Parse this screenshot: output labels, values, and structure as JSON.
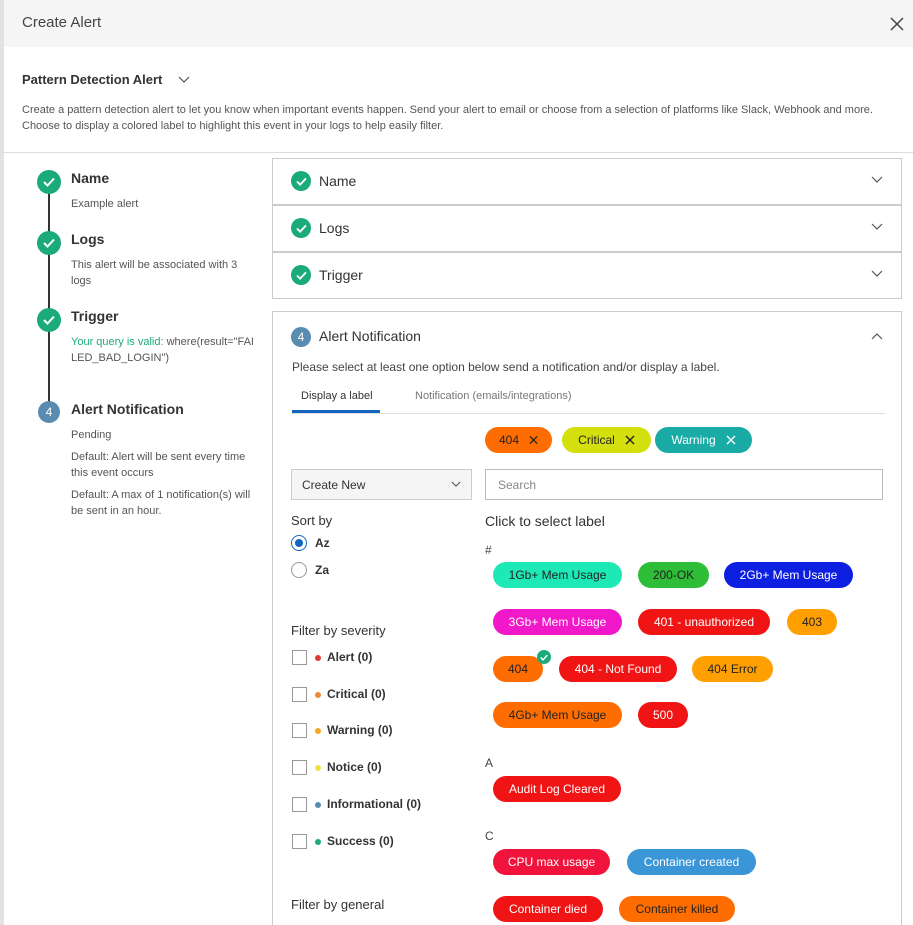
{
  "header": {
    "title": "Create Alert"
  },
  "alert_type": {
    "value": "Pattern Detection Alert"
  },
  "description": "Create a pattern detection alert to let you know when important events happen. Send your alert to email or choose from a selection of platforms like Slack, Webhook and more. Choose to display a colored label to highlight this event in your logs to help easily filter.",
  "steps": {
    "name": {
      "title": "Name",
      "desc": "Example alert"
    },
    "logs": {
      "title": "Logs",
      "desc": "This alert will be associated with 3 logs"
    },
    "trigger": {
      "title": "Trigger",
      "valid_text": "Your query is valid",
      "query": "where(result=\"FAILED_BAD_LOGIN\")"
    },
    "notification": {
      "number": "4",
      "title": "Alert Notification",
      "status": "Pending",
      "default1": "Default: Alert will be sent every time this event occurs",
      "default2": "Default: A max of 1 notification(s) will be sent in an hour."
    }
  },
  "panels": {
    "name": "Name",
    "logs": "Logs",
    "trigger": "Trigger"
  },
  "notification": {
    "number": "4",
    "title": "Alert Notification",
    "instruction": "Please select at least one option below send a notification and/or display a label.",
    "tabs": [
      "Display a label",
      "Notification (emails/integrations)"
    ],
    "selected": [
      {
        "label": "404",
        "bg": "#ff6d00",
        "color": "#222"
      },
      {
        "label": "Critical",
        "bg": "#d4e00e",
        "color": "#222"
      },
      {
        "label": "Warning",
        "bg": "#19aca6",
        "color": "#fff"
      }
    ],
    "dropdown": "Create New",
    "search_placeholder": "Search",
    "click_label": "Click to select label",
    "sort_by": "Sort by",
    "sort_options": [
      "Az",
      "Za"
    ],
    "filter_severity": "Filter by severity",
    "severities": [
      {
        "label": "Alert (0)",
        "color": "#e53935"
      },
      {
        "label": "Critical (0)",
        "color": "#ef8a33"
      },
      {
        "label": "Warning (0)",
        "color": "#f5a623"
      },
      {
        "label": "Notice (0)",
        "color": "#f5e04a"
      },
      {
        "label": "Informational (0)",
        "color": "#5a8bb0"
      },
      {
        "label": "Success (0)",
        "color": "#1aaa7c"
      }
    ],
    "filter_general": "Filter by general",
    "groups": [
      {
        "letter": "#",
        "labels": [
          {
            "label": "1Gb+ Mem Usage",
            "bg": "#1de9b6",
            "color": "#222"
          },
          {
            "label": "200-OK",
            "bg": "#2ebd36",
            "color": "#222"
          },
          {
            "label": "2Gb+ Mem Usage",
            "bg": "#0d1fe0",
            "color": "#fff"
          },
          {
            "label": "3Gb+ Mem Usage",
            "bg": "#f018c8",
            "color": "#fff"
          },
          {
            "label": "401 - unauthorized",
            "bg": "#f01414",
            "color": "#fff"
          },
          {
            "label": "403",
            "bg": "#ffa000",
            "color": "#222"
          },
          {
            "label": "404",
            "bg": "#ff6d00",
            "color": "#222"
          },
          {
            "label": "404 - Not Found",
            "bg": "#f01414",
            "color": "#fff"
          },
          {
            "label": "404 Error",
            "bg": "#ffa000",
            "color": "#222"
          },
          {
            "label": "4Gb+ Mem Usage",
            "bg": "#ff6d00",
            "color": "#222"
          },
          {
            "label": "500",
            "bg": "#f01414",
            "color": "#fff"
          }
        ]
      },
      {
        "letter": "A",
        "labels": [
          {
            "label": "Audit Log Cleared",
            "bg": "#f01414",
            "color": "#fff"
          }
        ]
      },
      {
        "letter": "C",
        "labels": [
          {
            "label": "CPU max usage",
            "bg": "#f0143c",
            "color": "#fff"
          },
          {
            "label": "Container created",
            "bg": "#3b96d8",
            "color": "#fff"
          },
          {
            "label": "Container died",
            "bg": "#f01414",
            "color": "#fff"
          },
          {
            "label": "Container killed",
            "bg": "#ff6d00",
            "color": "#222"
          }
        ]
      }
    ]
  }
}
